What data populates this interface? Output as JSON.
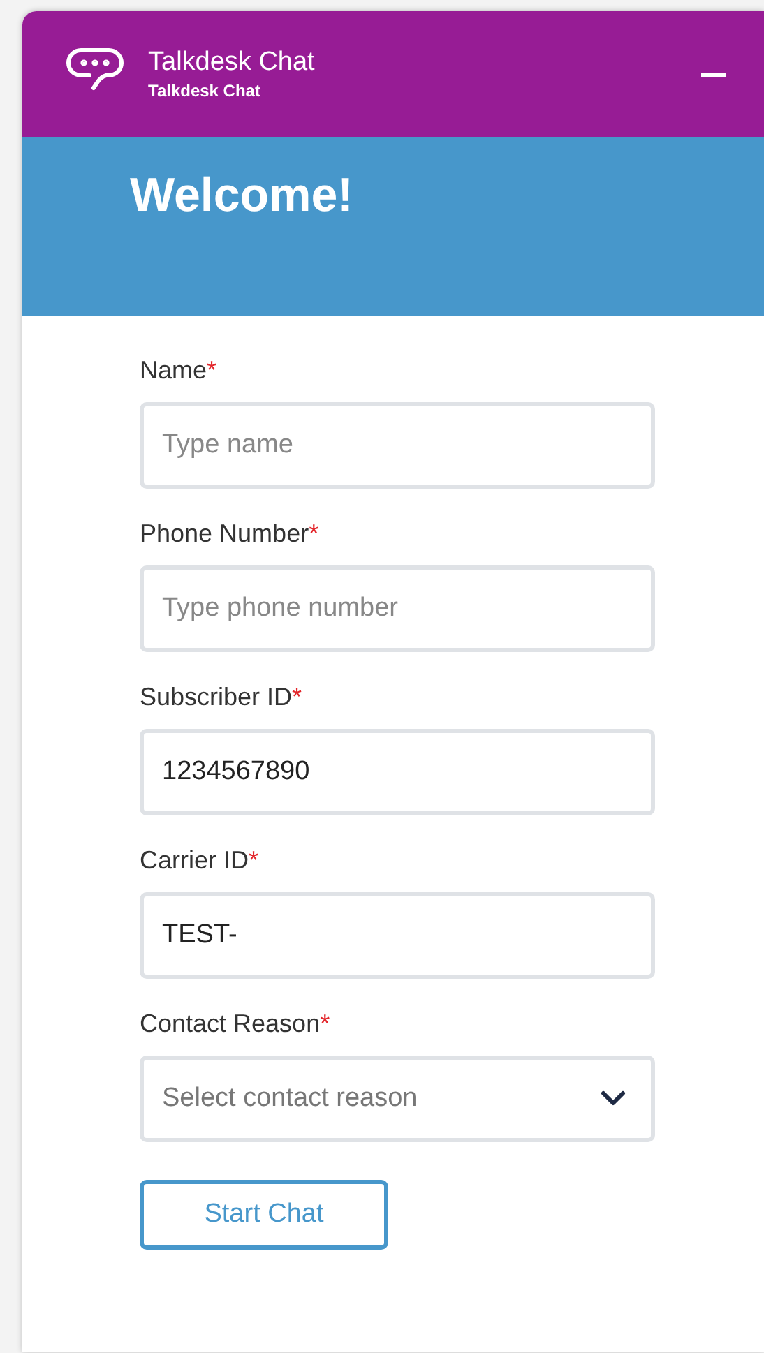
{
  "header": {
    "title": "Talkdesk Chat",
    "subtitle": "Talkdesk Chat"
  },
  "banner": {
    "title": "Welcome!"
  },
  "fields": [
    {
      "kind": "text",
      "label": "Name",
      "required_mark": "*",
      "placeholder": "Type name"
    },
    {
      "kind": "text",
      "label": "Phone Number",
      "required_mark": "*",
      "placeholder": "Type phone number"
    },
    {
      "kind": "text",
      "label": "Subscriber ID",
      "required_mark": "*",
      "value": "1234567890"
    },
    {
      "kind": "text",
      "label": "Carrier ID",
      "required_mark": "*",
      "value": "TEST-"
    },
    {
      "kind": "select",
      "label": "Contact Reason",
      "required_mark": "*",
      "placeholder": "Select contact reason"
    }
  ],
  "submit": {
    "label": "Start Chat"
  }
}
